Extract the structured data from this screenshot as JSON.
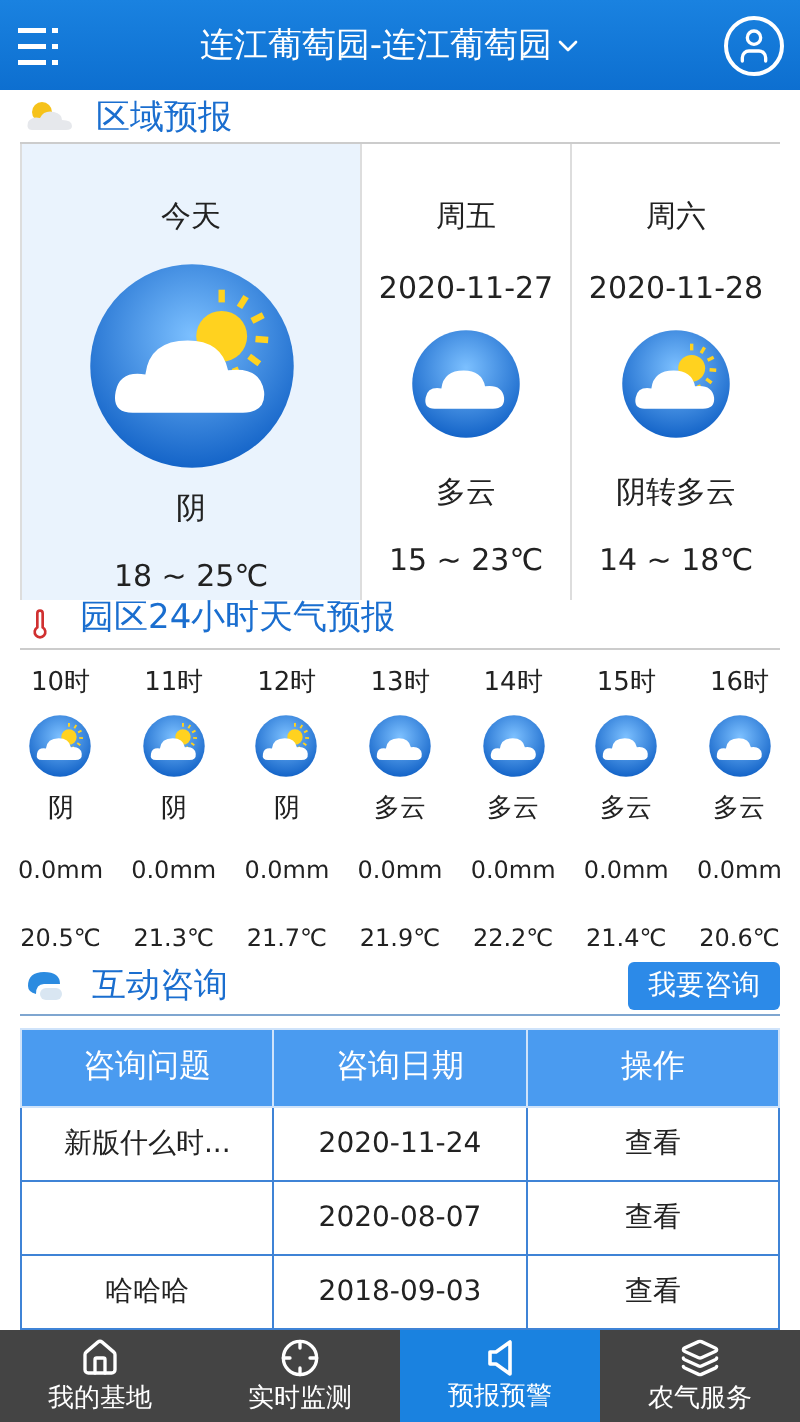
{
  "header": {
    "title": "连江葡萄园-连江葡萄园"
  },
  "region_forecast": {
    "title": "区域预报",
    "days": [
      {
        "day": "今天",
        "kind": "sun_cloud",
        "condition": "阴",
        "temp": "18 ~ 25℃",
        "selected": true
      },
      {
        "day": "周五",
        "date": "2020-11-27",
        "kind": "cloud",
        "condition": "多云",
        "temp": "15 ~ 23℃",
        "selected": false
      },
      {
        "day": "周六",
        "date": "2020-11-28",
        "kind": "sun_cloud",
        "condition": "阴转多云",
        "temp": "14 ~ 18℃",
        "selected": false
      }
    ]
  },
  "hourly_forecast": {
    "title": "园区24小时天气预报",
    "hours": [
      {
        "hour": "10时",
        "kind": "sun_cloud",
        "condition": "阴",
        "rain": "0.0mm",
        "temp": "20.5℃"
      },
      {
        "hour": "11时",
        "kind": "sun_cloud",
        "condition": "阴",
        "rain": "0.0mm",
        "temp": "21.3℃"
      },
      {
        "hour": "12时",
        "kind": "sun_cloud",
        "condition": "阴",
        "rain": "0.0mm",
        "temp": "21.7℃"
      },
      {
        "hour": "13时",
        "kind": "cloud",
        "condition": "多云",
        "rain": "0.0mm",
        "temp": "21.9℃"
      },
      {
        "hour": "14时",
        "kind": "cloud",
        "condition": "多云",
        "rain": "0.0mm",
        "temp": "22.2℃"
      },
      {
        "hour": "15时",
        "kind": "cloud",
        "condition": "多云",
        "rain": "0.0mm",
        "temp": "21.4℃"
      },
      {
        "hour": "16时",
        "kind": "cloud",
        "condition": "多云",
        "rain": "0.0mm",
        "temp": "20.6℃"
      }
    ]
  },
  "consultation": {
    "title": "互动咨询",
    "button": "我要咨询",
    "table": {
      "columns": [
        "咨询问题",
        "咨询日期",
        "操作"
      ],
      "rows": [
        [
          "新版什么时...",
          "2020-11-24",
          "查看"
        ],
        [
          "",
          "2020-08-07",
          "查看"
        ],
        [
          "哈哈哈",
          "2018-09-03",
          "查看"
        ]
      ]
    }
  },
  "bottom_nav": [
    {
      "label": "我的基地",
      "kind": "home",
      "selected": false
    },
    {
      "label": "实时监测",
      "kind": "target",
      "selected": false
    },
    {
      "label": "预报预警",
      "kind": "speaker",
      "selected": true
    },
    {
      "label": "农气服务",
      "kind": "layers",
      "selected": false
    }
  ]
}
